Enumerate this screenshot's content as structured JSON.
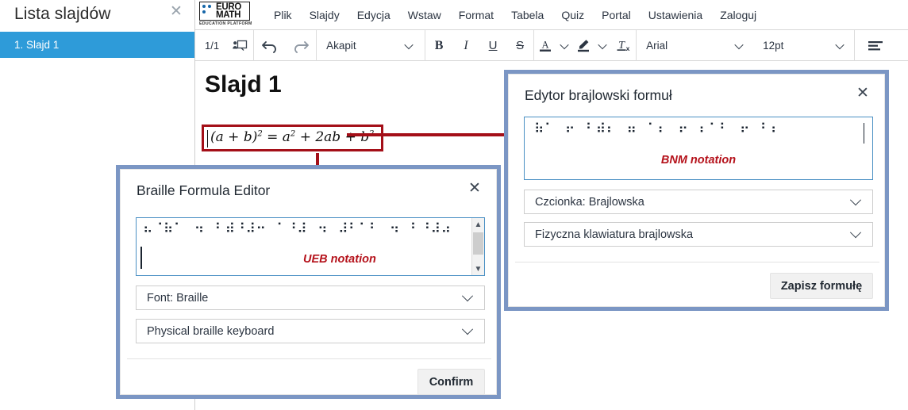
{
  "slide_panel": {
    "title": "Lista slajdów",
    "close_icon": "close-icon",
    "items": [
      {
        "label": "1. Slajd 1"
      }
    ]
  },
  "logo": {
    "word_top": "EURO",
    "word_bottom": "MATH",
    "subtitle": "EDUCATION PLATFORM"
  },
  "menu": {
    "items": [
      {
        "label": "Plik"
      },
      {
        "label": "Slajdy"
      },
      {
        "label": "Edycja"
      },
      {
        "label": "Wstaw"
      },
      {
        "label": "Format"
      },
      {
        "label": "Tabela"
      },
      {
        "label": "Quiz"
      },
      {
        "label": "Portal"
      },
      {
        "label": "Ustawienia"
      },
      {
        "label": "Zaloguj"
      }
    ]
  },
  "toolbar": {
    "page_count": "1/1",
    "presentation_icon": "presentation-icon",
    "undo_icon": "undo-icon",
    "redo_icon": "redo-icon",
    "paragraph_style": "Akapit",
    "bold": "B",
    "italic": "I",
    "underline": "U",
    "strikethrough": "S",
    "font_color_icon": "font-color-icon",
    "highlight_icon": "highlight-icon",
    "clear_format_icon": "clear-formatting-icon",
    "font_family": "Arial",
    "font_size": "12pt",
    "align_icon": "align-left-icon"
  },
  "slide": {
    "title": "Slajd 1",
    "formula": {
      "lhs": "(a + b)",
      "lhs_sup": "2",
      "eq": " = ",
      "t1": "a",
      "t1_sup": "2",
      "plus1": " + ",
      "t2": "2ab",
      "plus2": " + ",
      "t3": "b",
      "t3_sup": "2"
    }
  },
  "dialog_ueb": {
    "title": "Braille Formula Editor",
    "close_icon": "close-icon",
    "braille_text": "⠦⠈⠷⠁⠀⠲⠀⠃⠾⠘⠼⠒⠀⠁⠘⠼⠀⠲⠀⠼⠃⠁⠃⠀⠲⠀⠃⠘⠼⠴",
    "notation_label": "UEB notation",
    "scrollbar": {
      "up_icon": "chevron-up-icon",
      "down_icon": "chevron-down-icon"
    },
    "font_select": "Font: Braille",
    "keyboard_select": "Physical braille keyboard",
    "confirm_label": "Confirm"
  },
  "dialog_bnm": {
    "title": "Edytor brajlowski formuł",
    "close_icon": "close-icon",
    "braille_text": "⠷⠁⠀⠖⠀⠃⠾⠆⠀⠶⠀⠁⠆⠀⠖⠀⠆⠁⠃⠀⠖⠀⠃⠆",
    "notation_label": "BNM notation",
    "font_select": "Czcionka: Brajlowska",
    "keyboard_select": "Fizyczna klawiatura brajlowska",
    "save_label": "Zapisz formułę"
  },
  "colors": {
    "accent_blue": "#2e9bd9",
    "dialog_border": "#7b96c4",
    "annotation_red": "#a40f18",
    "notation_red": "#b5121b"
  }
}
